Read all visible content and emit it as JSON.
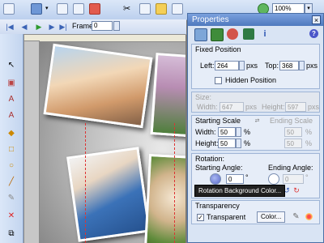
{
  "toolbar": {
    "zoom_value": "100%"
  },
  "playback": {
    "frame_label": "Frame:",
    "frame_value": "0"
  },
  "properties": {
    "title": "Properties",
    "fixed_position": {
      "title": "Fixed Position",
      "left_label": "Left:",
      "left_value": "264",
      "left_unit": "pxs",
      "top_label": "Top:",
      "top_value": "368",
      "top_unit": "pxs",
      "hidden_label": "Hidden Position"
    },
    "size": {
      "title": "Size:",
      "width_label": "Width:",
      "width_value": "647",
      "width_unit": "pxs",
      "height_label": "Height:",
      "height_value": "597",
      "height_unit": "pxs"
    },
    "scale": {
      "starting_title": "Starting Scale",
      "ending_title": "Ending Scale",
      "width_label": "Width:",
      "width_value": "50",
      "height_label": "Height:",
      "height_value": "50",
      "unit": "%",
      "end_width_value": "50",
      "end_height_value": "50"
    },
    "rotation": {
      "title": "Rotation:",
      "starting_label": "Starting Angle:",
      "ending_label": "Ending Angle:",
      "start_value": "0",
      "end_value": "0",
      "deg": "°"
    },
    "tooltip": "Rotation Background Color...",
    "transparency": {
      "title": "Transparency",
      "transparent_label": "Transparent",
      "color_button": "Color..."
    }
  }
}
